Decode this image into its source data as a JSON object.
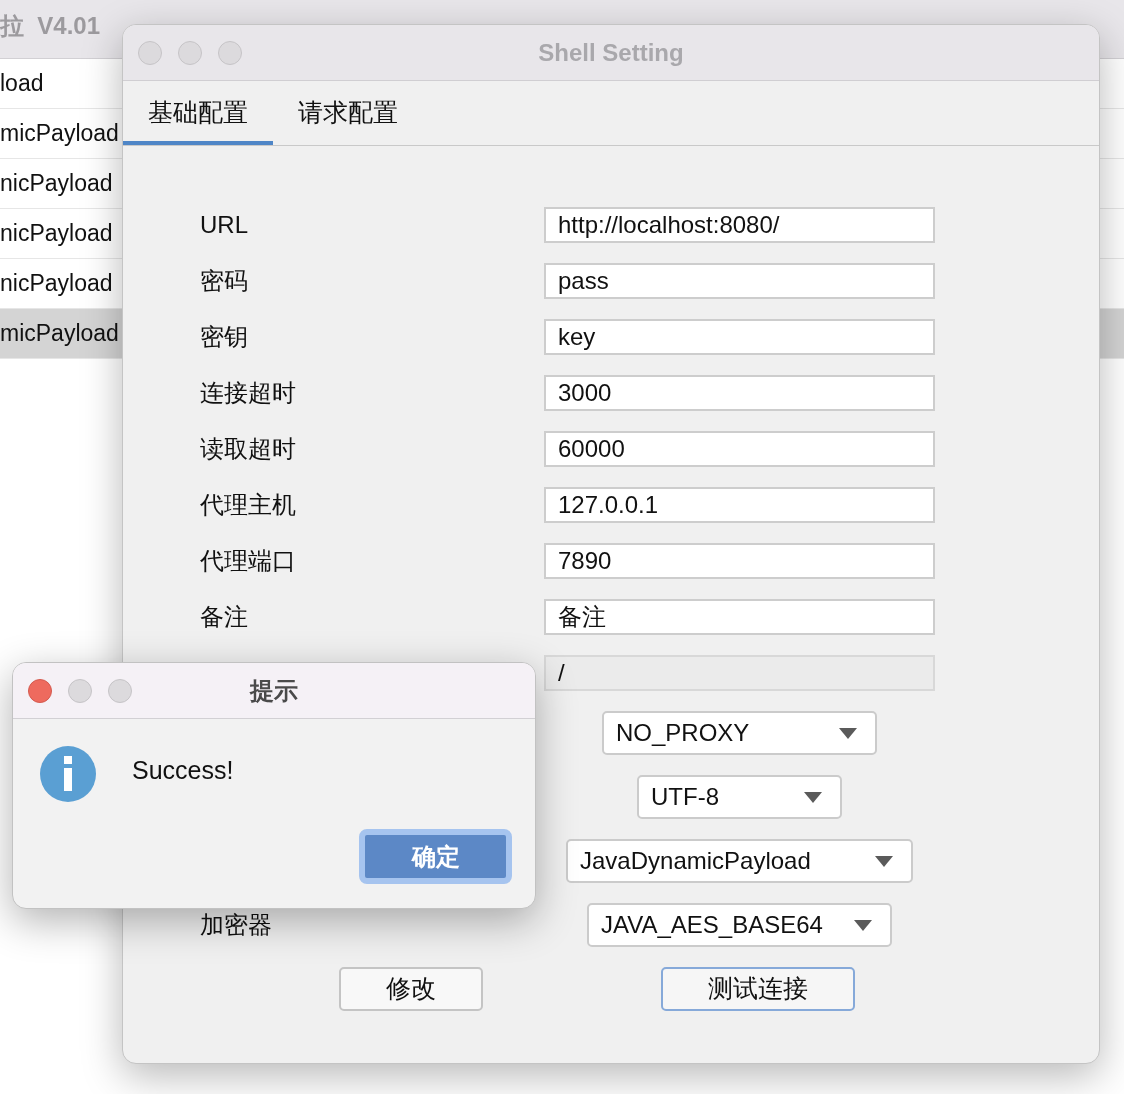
{
  "background_window": {
    "title": "拉  V4.01",
    "rows": [
      {
        "text": "load",
        "selected": false
      },
      {
        "text": "micPayload",
        "selected": false
      },
      {
        "text": "nicPayload",
        "selected": false
      },
      {
        "text": "nicPayload",
        "selected": false
      },
      {
        "text": "nicPayload",
        "selected": false
      },
      {
        "text": "micPayload",
        "selected": true
      }
    ]
  },
  "shell_setting": {
    "title": "Shell Setting",
    "active": false,
    "tabs": [
      {
        "label": "基础配置",
        "selected": true
      },
      {
        "label": "请求配置",
        "selected": false
      }
    ],
    "fields": [
      {
        "kind": "text",
        "label": "URL",
        "value": "http://localhost:8080/",
        "disabled": false
      },
      {
        "kind": "text",
        "label": "密码",
        "value": "pass",
        "disabled": false
      },
      {
        "kind": "text",
        "label": "密钥",
        "value": "key",
        "disabled": false
      },
      {
        "kind": "text",
        "label": "连接超时",
        "value": "3000",
        "disabled": false
      },
      {
        "kind": "text",
        "label": "读取超时",
        "value": "60000",
        "disabled": false
      },
      {
        "kind": "text",
        "label": "代理主机",
        "value": "127.0.0.1",
        "disabled": false
      },
      {
        "kind": "text",
        "label": "代理端口",
        "value": "7890",
        "disabled": false
      },
      {
        "kind": "text",
        "label": "备注",
        "value": "备注",
        "disabled": false
      },
      {
        "kind": "text",
        "value": "/",
        "disabled": true
      },
      {
        "kind": "select",
        "value": "NO_PROXY",
        "disabled": false
      },
      {
        "kind": "select",
        "value": "UTF-8",
        "disabled": false
      },
      {
        "kind": "select",
        "value": "JavaDynamicPayload",
        "disabled": false
      },
      {
        "kind": "select",
        "label": "加密器",
        "value": "JAVA_AES_BASE64",
        "disabled": false
      }
    ],
    "buttons": [
      {
        "label": "修改",
        "focused": false
      },
      {
        "label": "测试连接",
        "focused": true
      }
    ]
  },
  "dialog": {
    "title": "提示",
    "active": true,
    "message": "Success!",
    "buttons": [
      {
        "label": "确定",
        "default": true
      }
    ]
  }
}
